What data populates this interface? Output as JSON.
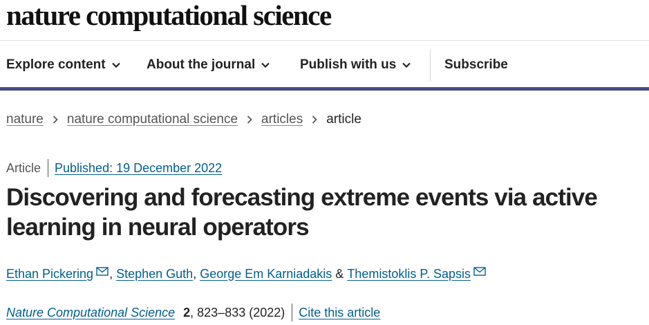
{
  "masthead": {
    "title": "nature computational science"
  },
  "nav": {
    "items": [
      {
        "label": "Explore content",
        "has_dropdown": true
      },
      {
        "label": "About the journal",
        "has_dropdown": true
      },
      {
        "label": "Publish with us",
        "has_dropdown": true
      },
      {
        "label": "Subscribe",
        "has_dropdown": false
      }
    ],
    "accent_color": "#4b4a8c"
  },
  "breadcrumb": {
    "items": [
      "nature",
      "nature computational science",
      "articles"
    ],
    "current": "article",
    "separator_icon": "chevron-right-icon"
  },
  "article": {
    "type": "Article",
    "published": "Published: 19 December 2022",
    "title": "Discovering and forecasting extreme events via active learning in neural operators",
    "authors": [
      {
        "name": "Ethan Pickering",
        "email_icon": true,
        "after": ", "
      },
      {
        "name": "Stephen Guth",
        "email_icon": false,
        "after": ", "
      },
      {
        "name": "George Em Karniadakis",
        "email_icon": false,
        "after": " & "
      },
      {
        "name": "Themistoklis P. Sapsis",
        "email_icon": true,
        "after": ""
      }
    ],
    "citation": {
      "journal": "Nature Computational Science",
      "volume": "2",
      "pages_year": ", 823–833 (2022)",
      "cite_label": "Cite this article"
    }
  },
  "colors": {
    "link": "#025e8d",
    "text": "#222222",
    "muted": "#555555"
  }
}
